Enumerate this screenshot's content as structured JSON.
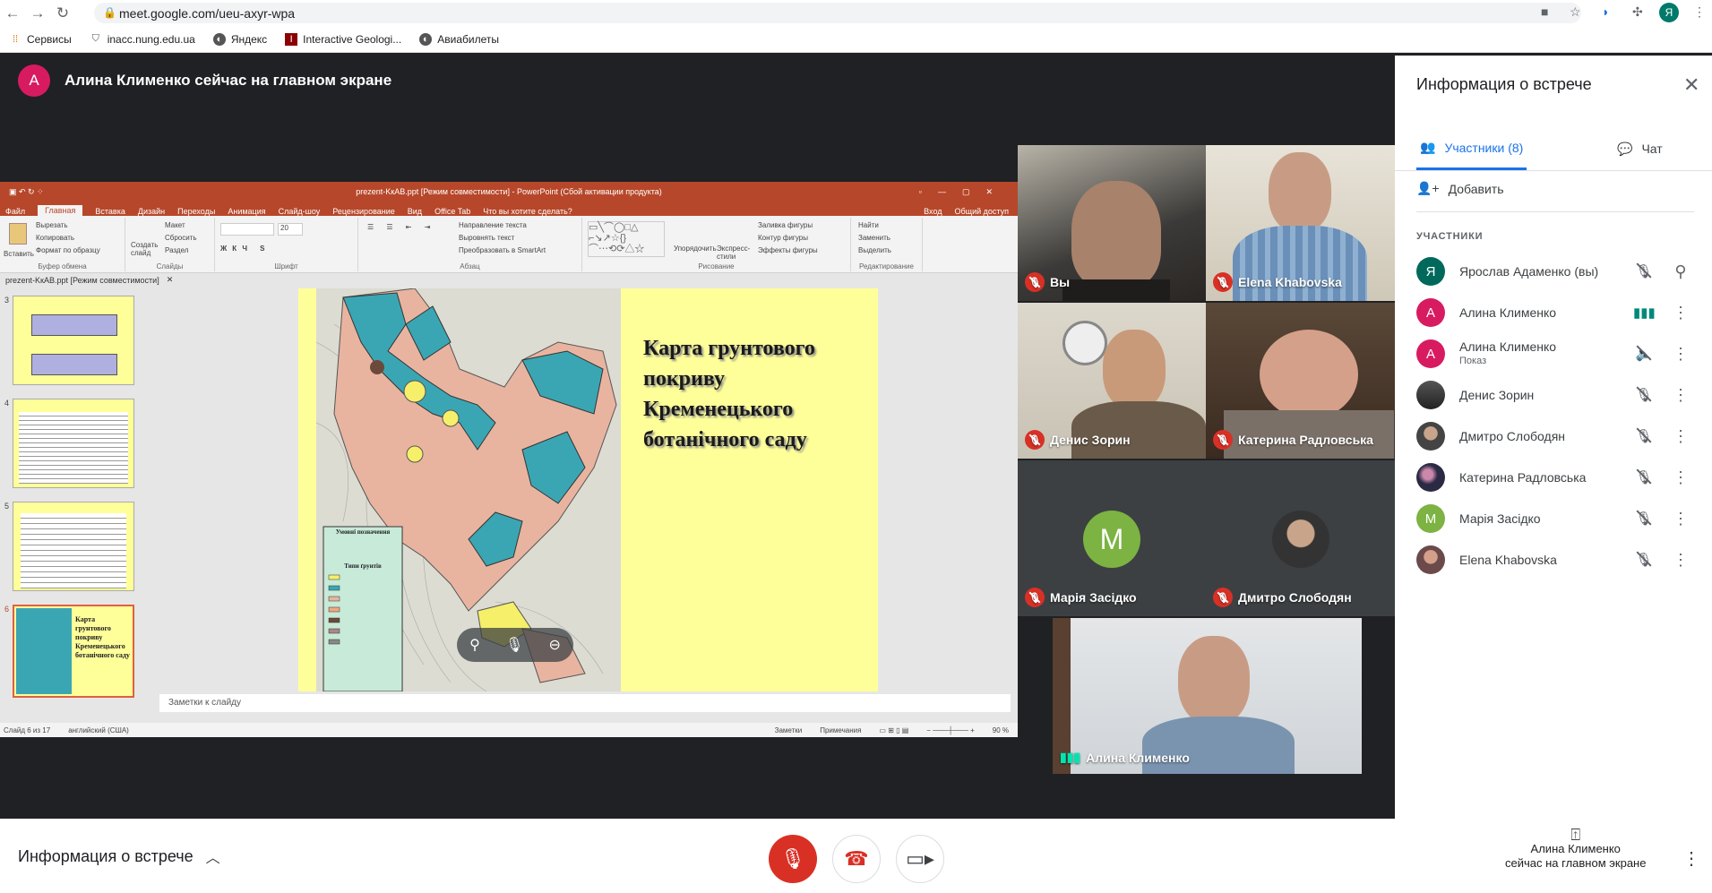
{
  "browser": {
    "url": "meet.google.com/ueu-axyr-wpa",
    "profile_initial": "Я",
    "bookmarks": [
      "Сервисы",
      "inacc.nung.edu.ua",
      "Яндекс",
      "Interactive Geologi...",
      "Авиабилеты"
    ]
  },
  "meet": {
    "presenter_initial": "А",
    "presenter_banner": "Алина Клименко сейчас на главном экране",
    "colors": {
      "accent": "#1a73e8",
      "danger": "#d93025",
      "pink": "#d81b60",
      "green": "#7cb342",
      "teal": "#00897b"
    }
  },
  "ppt": {
    "window_title": "prezent-KкАВ.ppt [Режим совместимости] - PowerPoint (Сбой активации продукта)",
    "tabs": [
      "Файл",
      "Главная",
      "Вставка",
      "Дизайн",
      "Переходы",
      "Анимация",
      "Слайд-шоу",
      "Рецензирование",
      "Вид",
      "Office Tab",
      "Что вы хотите сделать?"
    ],
    "login": "Вход",
    "share": "Общий доступ",
    "ribbon": {
      "paste": "Вставить",
      "cut": "Вырезать",
      "copy": "Копировать",
      "format_painter": "Формат по образцу",
      "clipboard": "Буфер обмена",
      "new_slide": "Создать слайд",
      "layout": "Макет",
      "reset": "Сбросить",
      "section": "Раздел",
      "slides": "Слайды",
      "font": "Шрифт",
      "font_size": "20",
      "paragraph": "Абзац",
      "text_dir": "Направление текста",
      "align_text": "Выровнять текст",
      "smartart": "Преобразовать в SmartArt",
      "arrange": "Упорядочить",
      "quick_styles": "Экспресс-стили",
      "fill": "Заливка фигуры",
      "outline": "Контур фигуры",
      "effects": "Эффекты фигуры",
      "drawing": "Рисование",
      "find": "Найти",
      "replace": "Заменить",
      "select": "Выделить",
      "editing": "Редактирование"
    },
    "doc_tab": "prezent-KкАВ.ppt [Режим совместимости]",
    "thumb_numbers": [
      "3",
      "4",
      "5",
      "6"
    ],
    "thumb6_text": "Карта грунтового покриву Кременецького ботанічного саду",
    "slide_title": "Карта грунтового покриву Кременецького ботанічного саду",
    "legend_title": "Умовні позначення",
    "legend_sub": "Типи ґрунтів",
    "notes": "Заметки к слайду",
    "status_slide": "Слайд 6 из 17",
    "status_lang": "английский (США)",
    "status_notes": "Заметки",
    "status_comments": "Примечания",
    "zoom": "90 %"
  },
  "tiles": [
    {
      "name": "Вы",
      "muted": true
    },
    {
      "name": "Elena Khabovska",
      "muted": true
    },
    {
      "name": "Денис Зорин",
      "muted": true
    },
    {
      "name": "Катерина Радловська",
      "muted": true
    },
    {
      "name": "Марія Засідко",
      "muted": true,
      "initial": "M"
    },
    {
      "name": "Дмитро Слободян",
      "muted": true
    },
    {
      "name": "Алина Клименко",
      "muted": false
    }
  ],
  "panel": {
    "title": "Информация о встрече",
    "tab_people": "Участники (8)",
    "tab_chat": "Чат",
    "add": "Добавить",
    "section_label": "УЧАСТНИКИ",
    "participants": [
      {
        "initial": "Я",
        "name": "Ярослав Адаменко (вы)",
        "sub": "",
        "mic": "off",
        "action": "pin"
      },
      {
        "initial": "А",
        "name": "Алина Клименко",
        "sub": "",
        "mic": "speaking",
        "action": "more"
      },
      {
        "initial": "А",
        "name": "Алина Клименко",
        "sub": "Показ",
        "mic": "presenting",
        "action": "more"
      },
      {
        "initial": "",
        "name": "Денис Зорин",
        "sub": "",
        "mic": "off",
        "action": "more"
      },
      {
        "initial": "",
        "name": "Дмитро Слободян",
        "sub": "",
        "mic": "off",
        "action": "more"
      },
      {
        "initial": "",
        "name": "Катерина Радловська",
        "sub": "",
        "mic": "off",
        "action": "more"
      },
      {
        "initial": "M",
        "name": "Марія Засідко",
        "sub": "",
        "mic": "off",
        "action": "more"
      },
      {
        "initial": "",
        "name": "Elena Khabovska",
        "sub": "",
        "mic": "off",
        "action": "more"
      }
    ]
  },
  "bottom": {
    "info": "Информация о встрече",
    "presenting_line1": "Алина Клименко",
    "presenting_line2": "сейчас на главном экране"
  }
}
